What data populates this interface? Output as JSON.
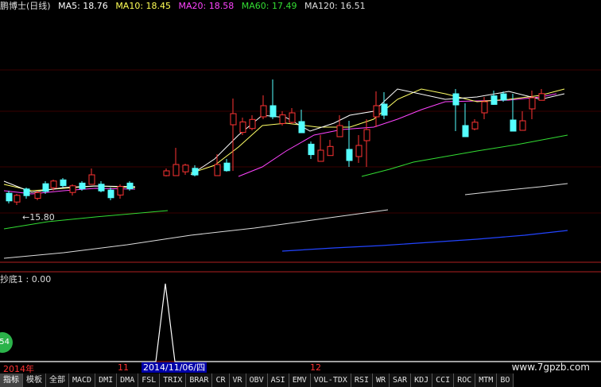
{
  "header": {
    "title": "鹏博士(日线)",
    "ma": [
      {
        "label": "MA5: 18.76",
        "color": "#ffffff"
      },
      {
        "label": "MA10: 18.45",
        "color": "#ffff55"
      },
      {
        "label": "MA20: 18.58",
        "color": "#ff44ff"
      },
      {
        "label": "MA60: 17.49",
        "color": "#33dd33"
      },
      {
        "label": "MA120: 16.51",
        "color": "#dddddd"
      }
    ]
  },
  "low_label": "←15.80",
  "indicator": {
    "title": "抄底1 : 0.00"
  },
  "dates": {
    "year": "2014年",
    "m11": "11",
    "cursor": "2014/11/06/四",
    "m12": "12"
  },
  "badge": "54",
  "watermark": "www.7gpzb.com",
  "tabs": [
    "指标",
    "模板",
    "全部",
    "MACD",
    "DMI",
    "DMA",
    "FSL",
    "TRIX",
    "BRAR",
    "CR",
    "VR",
    "OBV",
    "ASI",
    "EMV",
    "VOL-TDX",
    "RSI",
    "WR",
    "SAR",
    "KDJ",
    "CCI",
    "ROC",
    "MTM",
    "BO"
  ],
  "colors": {
    "up": "#ff3333",
    "down": "#55ffff",
    "border": "#b02020"
  }
}
